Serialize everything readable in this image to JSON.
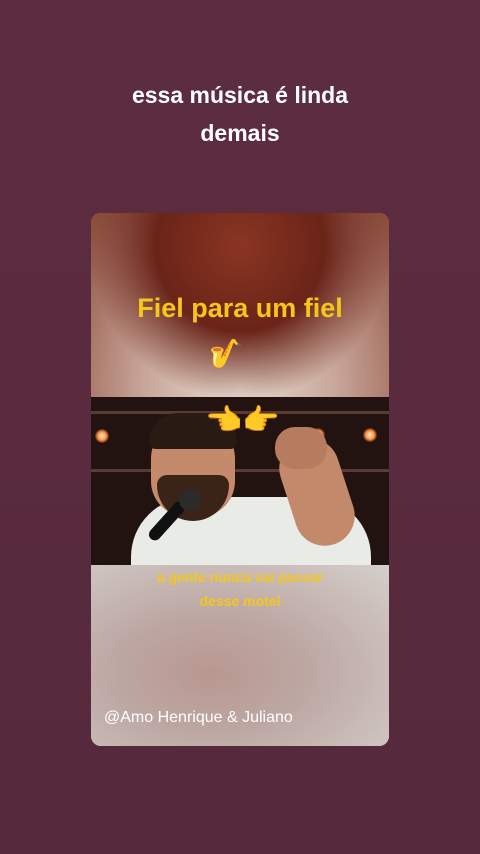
{
  "post": {
    "caption": "essa música é linda\ndemais"
  },
  "card": {
    "title": "Fiel para um fiel",
    "title_emoji": "🎷",
    "photo_emoji": "👈👉",
    "lyric": "a gente nunca vai passar\ndesse motel",
    "credit": "@Amo Henrique & Juliano"
  },
  "colors": {
    "background": "#5a2b3f",
    "title_yellow": "#f5c71a",
    "text_white": "#ffffff"
  }
}
